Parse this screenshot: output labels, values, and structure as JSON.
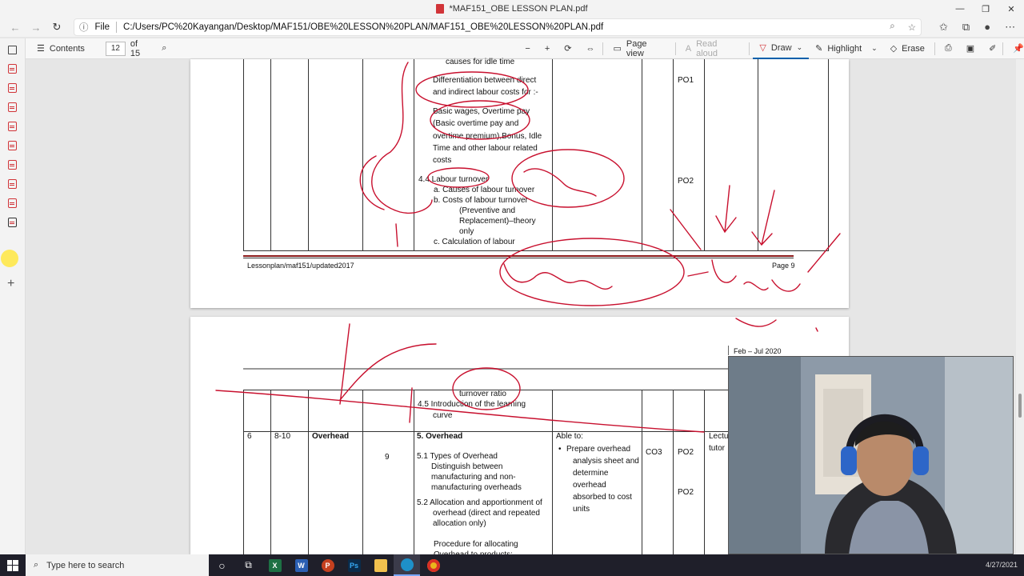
{
  "window": {
    "title": "*MAF151_OBE LESSON PLAN.pdf"
  },
  "address": {
    "prefix": "File",
    "url": "C:/Users/PC%20Kayangan/Desktop/MAF151/OBE%20LESSON%20PLAN/MAF151_OBE%20LESSON%20PLAN.pdf"
  },
  "toolbar": {
    "contents": "Contents",
    "page_current": "12",
    "page_total": "of 15",
    "page_view": "Page view",
    "read_aloud": "Read aloud",
    "draw": "Draw",
    "highlight": "Highlight",
    "erase": "Erase"
  },
  "page1": {
    "lines": [
      "causes for idle time",
      "Differentiation between direct",
      "and indirect labour costs for :-",
      "Basic wages, Overtime pay",
      "(Basic overtime pay and",
      "overtime premium),Bonus, Idle",
      "Time and other labour related",
      "costs",
      "4.4 Labour turnover",
      "a. Causes of labour turnover",
      "b. Costs of labour turnover",
      "(Preventive and",
      "Replacement)–theory",
      "only",
      "c. Calculation of labour"
    ],
    "po1": "PO1",
    "po2": "PO2",
    "footer_left": "Lessonplan/maf151/updated2017",
    "footer_right": "Page 9"
  },
  "page2": {
    "header_right": "Feb – Jul 2020",
    "top_lines": [
      "turnover ratio",
      "4.5 Introduction of the learning",
      "curve"
    ],
    "row": {
      "no": "6",
      "week": "8-10",
      "topic": "Overhead",
      "hours": "9",
      "heading": "5.  Overhead",
      "content": [
        "5.1 Types of Overhead",
        "Distinguish between",
        "manufacturing and non-",
        "manufacturing overheads",
        "5.2 Allocation and apportionment of",
        "overhead (direct and repeated",
        "allocation only)",
        "Procedure for allocating",
        "Overhead to products:"
      ],
      "able_to": "Able to:",
      "outcome": [
        "Prepare overhead",
        "analysis sheet and",
        "determine",
        "overhead",
        "absorbed to cost",
        "units"
      ],
      "co": "CO3",
      "po_a": "PO2",
      "po_b": "PO2",
      "method": [
        "Lectu",
        "tutor"
      ]
    }
  },
  "taskbar": {
    "search_placeholder": "Type here to search",
    "date": "4/27/2021"
  }
}
